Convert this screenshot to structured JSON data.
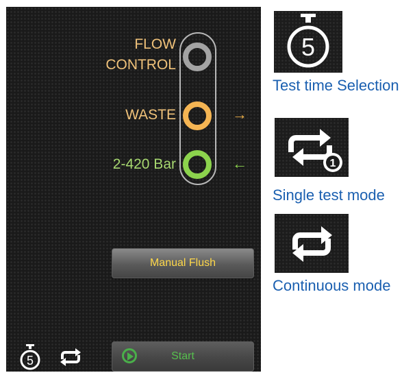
{
  "device": {
    "indicators": [
      {
        "label": "FLOW\nCONTROL",
        "color": "#a3a3a3",
        "icon": "gray-ring-icon"
      },
      {
        "label": "WASTE",
        "color": "#f5b553",
        "icon": "orange-ring-icon",
        "arrow": "→"
      },
      {
        "label": "2-420 Bar",
        "color": "#8cd34d",
        "icon": "green-ring-icon",
        "arrow": "←"
      }
    ],
    "manual_flush_label": "Manual Flush",
    "start_label": "Start",
    "bottom_icons": {
      "timer_digit": "5",
      "timer_icon": "stopwatch-icon",
      "mode_icon": "repeat-icon"
    }
  },
  "legend": [
    {
      "icon": "stopwatch-icon",
      "digit": "5",
      "label": "Test time Selection"
    },
    {
      "icon": "repeat-once-icon",
      "digit": "1",
      "label": "Single test mode"
    },
    {
      "icon": "repeat-icon",
      "label": "Continuous mode"
    }
  ],
  "colors": {
    "label_orange": "#f0c27a",
    "label_green": "#a7d870",
    "manual_text": "#ffd84a",
    "start_text": "#57c04e",
    "legend_blue": "#1a5fb0"
  }
}
